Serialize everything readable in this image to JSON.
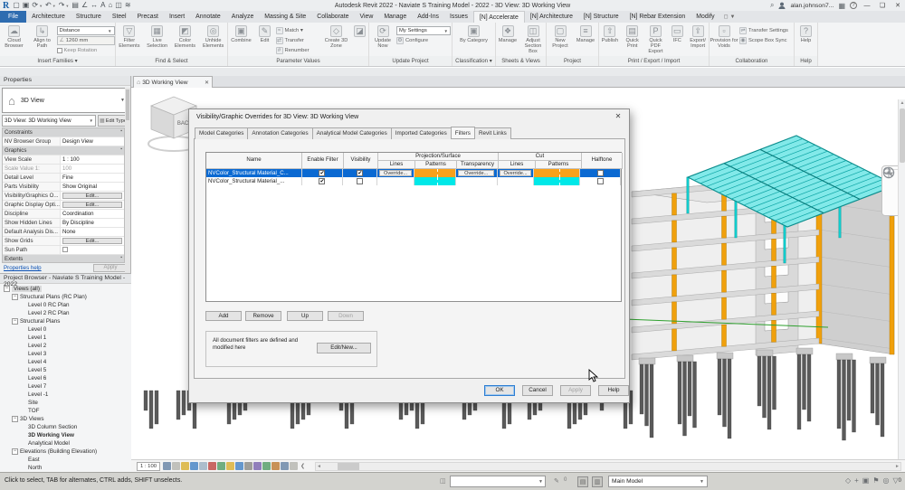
{
  "window": {
    "title": "Autodesk Revit 2022 - Naviate S Training Model - 2022 - 3D View: 3D Working View",
    "user": "alan.johnson7...",
    "qat_icons": [
      {
        "name": "open-icon",
        "g": "▢"
      },
      {
        "name": "save-icon",
        "g": "▣"
      },
      {
        "name": "sync-icon",
        "g": "⟳",
        "dd": true
      },
      {
        "name": "undo-icon",
        "g": "↶",
        "dd": true
      },
      {
        "name": "redo-icon",
        "g": "↷",
        "dd": true
      },
      {
        "name": "print-icon",
        "g": "▤"
      },
      {
        "name": "measure-icon",
        "g": "∠"
      },
      {
        "name": "dimension-icon",
        "g": "↔"
      },
      {
        "name": "text-icon",
        "g": "A"
      },
      {
        "name": "3d-view-icon",
        "g": "⌂"
      },
      {
        "name": "section-icon",
        "g": "◫"
      },
      {
        "name": "thin-lines-icon",
        "g": "≋"
      }
    ]
  },
  "ribbon": {
    "tabs": [
      {
        "label": "File",
        "kind": "file"
      },
      {
        "label": "Architecture"
      },
      {
        "label": "Structure"
      },
      {
        "label": "Steel"
      },
      {
        "label": "Precast"
      },
      {
        "label": "Insert"
      },
      {
        "label": "Annotate"
      },
      {
        "label": "Analyze"
      },
      {
        "label": "Massing & Site"
      },
      {
        "label": "Collaborate"
      },
      {
        "label": "View"
      },
      {
        "label": "Manage"
      },
      {
        "label": "Add-Ins"
      },
      {
        "label": "Issues"
      },
      {
        "label": "[N] Accelerate",
        "active": true
      },
      {
        "label": "[N] Architecture"
      },
      {
        "label": "[N] Structure"
      },
      {
        "label": "[N] Rebar Extension"
      },
      {
        "label": "Modify"
      }
    ],
    "panels": [
      {
        "label": "Insert Families",
        "dropdown": true,
        "width": 128,
        "tools": [
          {
            "kind": "big",
            "label": "Cloud Browser",
            "icon": "cloud-browser-icon",
            "glyph": "☁",
            "w": 30
          },
          {
            "kind": "big",
            "label": "Align to Path",
            "icon": "align-to-path-icon",
            "glyph": "↳",
            "w": 30
          },
          {
            "kind": "controls",
            "w": 64,
            "items": [
              {
                "type": "combo",
                "value": "Distance"
              },
              {
                "type": "field",
                "value": "1260 mm",
                "glyph": "∠"
              },
              {
                "type": "check",
                "label": "Keep Rotation"
              }
            ]
          }
        ]
      },
      {
        "label": "Find & Select",
        "width": 124,
        "tools": [
          {
            "kind": "big",
            "label": "Filter Elements",
            "icon": "filter-elements-icon",
            "glyph": "▽",
            "w": 30
          },
          {
            "kind": "big",
            "label": "Live Selection",
            "icon": "live-selection-icon",
            "glyph": "▦",
            "w": 30
          },
          {
            "kind": "big",
            "label": "Color Elements",
            "icon": "color-elements-icon",
            "glyph": "◩",
            "w": 30
          },
          {
            "kind": "big",
            "label": "Unhide Elements",
            "icon": "unhide-elements-icon",
            "glyph": "◎",
            "w": 31
          }
        ]
      },
      {
        "label": "Parameter Values",
        "width": 156,
        "tools": [
          {
            "kind": "big",
            "label": "Combine",
            "icon": "combine-icon",
            "glyph": "▣",
            "w": 28
          },
          {
            "kind": "big",
            "label": "Edit",
            "icon": "edit-icon",
            "glyph": "✎",
            "w": 22
          },
          {
            "kind": "stack",
            "w": 50,
            "items": [
              {
                "label": "Match",
                "glyph": "≈",
                "dd": true
              },
              {
                "label": "Transfer",
                "glyph": "⇄"
              },
              {
                "label": "Renumber",
                "glyph": "#"
              }
            ]
          },
          {
            "kind": "big",
            "label": "Create 3D Zone",
            "icon": "create-3d-zone-icon",
            "glyph": "◇",
            "w": 32
          },
          {
            "kind": "big",
            "label": "",
            "icon": "zone-box-icon",
            "glyph": "◪",
            "w": 18
          }
        ]
      },
      {
        "label": "Update Project",
        "width": 92,
        "tools": [
          {
            "kind": "big",
            "label": "Update Now",
            "icon": "update-now-icon",
            "glyph": "⟳",
            "w": 28
          },
          {
            "kind": "controls",
            "w": 60,
            "items": [
              {
                "type": "combo",
                "value": "My Settings"
              },
              {
                "type": "small",
                "label": "Configure",
                "glyph": "⚙"
              }
            ]
          }
        ]
      },
      {
        "label": "Classification",
        "dropdown": true,
        "width": 48,
        "tools": [
          {
            "kind": "big",
            "label": "By Category",
            "icon": "by-category-icon",
            "glyph": "▣",
            "w": 40
          }
        ]
      },
      {
        "label": "Sheets & Views",
        "width": 56,
        "tools": [
          {
            "kind": "big",
            "label": "Manage",
            "icon": "manage-views-icon",
            "glyph": "❖",
            "w": 26
          },
          {
            "kind": "big",
            "label": "Adjust Section Box",
            "icon": "adjust-section-box-icon",
            "glyph": "◫",
            "w": 28
          }
        ]
      },
      {
        "label": "Project",
        "width": 58,
        "tools": [
          {
            "kind": "big",
            "label": "New Project",
            "icon": "new-project-icon",
            "glyph": "▢",
            "w": 28
          },
          {
            "kind": "big",
            "label": "Manage",
            "icon": "manage-project-icon",
            "glyph": "≡",
            "w": 26
          }
        ]
      },
      {
        "label": "Print / Export / Import",
        "width": 122,
        "tools": [
          {
            "kind": "big",
            "label": "Publish",
            "icon": "publish-icon",
            "glyph": "⇧",
            "w": 24
          },
          {
            "kind": "big",
            "label": "Quick Print",
            "icon": "quick-print-icon",
            "glyph": "▤",
            "w": 24
          },
          {
            "kind": "big",
            "label": "Quick PDF Export",
            "icon": "quick-pdf-export-icon",
            "glyph": "P",
            "w": 26
          },
          {
            "kind": "big",
            "label": "IFC",
            "icon": "ifc-icon",
            "glyph": "▭",
            "w": 20
          },
          {
            "kind": "big",
            "label": "Export/ Import",
            "icon": "export-import-icon",
            "glyph": "⇪",
            "w": 24
          }
        ]
      },
      {
        "label": "Collaboration",
        "width": 94,
        "tools": [
          {
            "kind": "big",
            "label": "Provision for Voids",
            "icon": "provision-voids-icon",
            "glyph": "▫",
            "w": 32
          },
          {
            "kind": "stack",
            "w": 60,
            "items": [
              {
                "label": "Transfer Settings",
                "glyph": "⇌"
              },
              {
                "label": "Scope Box Sync",
                "glyph": "◉"
              }
            ]
          }
        ]
      },
      {
        "label": "Help",
        "width": 26,
        "tools": [
          {
            "kind": "big",
            "label": "Help",
            "icon": "help-icon",
            "glyph": "?",
            "w": 24
          }
        ]
      }
    ]
  },
  "properties": {
    "header": "Properties",
    "type_selector": "3D View",
    "instance": "3D View: 3D Working View",
    "edit_type": "Edit Type",
    "rows": [
      {
        "type": "section",
        "label": "Constraints"
      },
      {
        "type": "text",
        "label": "NV Browser Group",
        "value": "Design View"
      },
      {
        "type": "section",
        "label": "Graphics"
      },
      {
        "type": "text",
        "label": "View Scale",
        "value": "1 : 100"
      },
      {
        "type": "text",
        "label": "Scale Value    1:",
        "value": "100",
        "muted": true
      },
      {
        "type": "text",
        "label": "Detail Level",
        "value": "Fine"
      },
      {
        "type": "text",
        "label": "Parts Visibility",
        "value": "Show Original"
      },
      {
        "type": "button",
        "label": "Visibility/Graphics O...",
        "value": "Edit..."
      },
      {
        "type": "button",
        "label": "Graphic Display Opti...",
        "value": "Edit..."
      },
      {
        "type": "text",
        "label": "Discipline",
        "value": "Coordination"
      },
      {
        "type": "text",
        "label": "Show Hidden Lines",
        "value": "By Discipline"
      },
      {
        "type": "text",
        "label": "Default Analysis Dis...",
        "value": "None"
      },
      {
        "type": "button",
        "label": "Show Grids",
        "value": "Edit..."
      },
      {
        "type": "checkbox",
        "label": "Sun Path",
        "checked": false
      },
      {
        "type": "section",
        "label": "Extents"
      }
    ],
    "footer": {
      "help": "Properties help",
      "apply": "Apply"
    }
  },
  "browser": {
    "header": "Project Browser - Naviate S Training Model - 2022",
    "items": [
      {
        "indent": 0,
        "exp": true,
        "label": "Views (all)",
        "highlight": true
      },
      {
        "indent": 1,
        "exp": true,
        "label": "Structural Plans (RC Plan)"
      },
      {
        "indent": 2,
        "label": "Level 0 RC Plan"
      },
      {
        "indent": 2,
        "label": "Level 2 RC Plan"
      },
      {
        "indent": 1,
        "exp": true,
        "label": "Structural Plans"
      },
      {
        "indent": 2,
        "label": "Level 0"
      },
      {
        "indent": 2,
        "label": "Level 1"
      },
      {
        "indent": 2,
        "label": "Level 2"
      },
      {
        "indent": 2,
        "label": "Level 3"
      },
      {
        "indent": 2,
        "label": "Level 4"
      },
      {
        "indent": 2,
        "label": "Level 5"
      },
      {
        "indent": 2,
        "label": "Level 6"
      },
      {
        "indent": 2,
        "label": "Level 7"
      },
      {
        "indent": 2,
        "label": "Level -1"
      },
      {
        "indent": 2,
        "label": "Site"
      },
      {
        "indent": 2,
        "label": "TOF"
      },
      {
        "indent": 1,
        "exp": true,
        "label": "3D Views"
      },
      {
        "indent": 2,
        "label": "3D Column Section"
      },
      {
        "indent": 2,
        "label": "3D Working View",
        "bold": true
      },
      {
        "indent": 2,
        "label": "Analytical Model"
      },
      {
        "indent": 1,
        "exp": true,
        "label": "Elevations (Building Elevation)"
      },
      {
        "indent": 2,
        "label": "East"
      },
      {
        "indent": 2,
        "label": "North"
      }
    ]
  },
  "viewport": {
    "tab": "3D Working View",
    "viewcube_face": "BACK",
    "scale": "1 : 100",
    "vcb_icons": [
      {
        "name": "model-display-icon",
        "c": "#6b87a8"
      },
      {
        "name": "detail-level-icon",
        "c": "#b7b7b2"
      },
      {
        "name": "visual-style-icon",
        "c": "#d9b23a"
      },
      {
        "name": "sun-path-icon",
        "c": "#4a86c6"
      },
      {
        "name": "shadows-icon",
        "c": "#9fb3c4"
      },
      {
        "name": "render-icon",
        "c": "#c04f4a"
      },
      {
        "name": "crop-view-icon",
        "c": "#58a06b"
      },
      {
        "name": "show-crop-icon",
        "c": "#d9b23a"
      },
      {
        "name": "lock-view-icon",
        "c": "#4a86c6"
      },
      {
        "name": "temporary-hide-icon",
        "c": "#8e8e8a"
      },
      {
        "name": "reveal-hidden-icon",
        "c": "#7f6ab0"
      },
      {
        "name": "worksharing-display-icon",
        "c": "#58a06b"
      },
      {
        "name": "temporary-view-icon",
        "c": "#c07f3a"
      },
      {
        "name": "analytical-model-icon",
        "c": "#6b87a8"
      },
      {
        "name": "constraints-icon",
        "c": "#b7b7b2"
      }
    ]
  },
  "dialog": {
    "title": "Visibility/Graphic Overrides for 3D View: 3D Working View",
    "tabs": [
      "Model Categories",
      "Annotation Categories",
      "Analytical Model Categories",
      "Imported Categories",
      "Filters",
      "Revit Links"
    ],
    "active_tab": "Filters",
    "table": {
      "group_headers": [
        {
          "label": "Projection/Surface"
        },
        {
          "label": "Cut"
        }
      ],
      "columns": [
        "Name",
        "Enable Filter",
        "Visibility",
        "Lines",
        "Patterns",
        "Transparency",
        "Lines",
        "Patterns",
        "Halftone"
      ],
      "override_label": "Override...",
      "rows": [
        {
          "name": "NVColor_Structural Material_C...",
          "selected": true,
          "enable": true,
          "visibility": true,
          "projection_lines": "Override...",
          "projection_pattern": "#f9a11b",
          "transparency": "Override...",
          "cut_lines": "Override...",
          "cut_pattern": "#f9a11b",
          "halftone": false
        },
        {
          "name": "NVColor_Structural Material_...",
          "selected": false,
          "enable": true,
          "visibility": false,
          "projection_lines": "",
          "projection_pattern": "#00e8e8",
          "transparency": "",
          "cut_lines": "",
          "cut_pattern": "#00e8e8",
          "halftone": false
        }
      ]
    },
    "buttons": [
      {
        "label": "Add"
      },
      {
        "label": "Remove"
      },
      {
        "label": "Up"
      },
      {
        "label": "Down",
        "disabled": true
      }
    ],
    "note": "All document filters are defined and modified here",
    "edit_new": "Edit/New...",
    "footer_buttons": [
      {
        "label": "OK",
        "focused": true
      },
      {
        "label": "Cancel"
      },
      {
        "label": "Apply",
        "disabled": true
      },
      {
        "label": "Help"
      }
    ]
  },
  "statusbar": {
    "hint": "Click to select, TAB for alternates, CTRL adds, SHIFT unselects.",
    "workset_value": "",
    "main_model": "Main Model",
    "filter_count": "0",
    "right_icons": [
      {
        "name": "reveal-constraints-icon",
        "g": "◇"
      },
      {
        "name": "press-drag-icon",
        "g": "+"
      },
      {
        "name": "exclude-options-icon",
        "g": "▣"
      },
      {
        "name": "background-processes-icon",
        "g": "⚑"
      },
      {
        "name": "select-underlay-icon",
        "g": "◎"
      }
    ]
  },
  "colors": {
    "selection_blue": "#0a69d2",
    "pattern_orange": "#f9a11b",
    "pattern_cyan": "#00e8e8",
    "column_orange": "#f0a00c",
    "deck_cyan": "#82e9e9"
  }
}
